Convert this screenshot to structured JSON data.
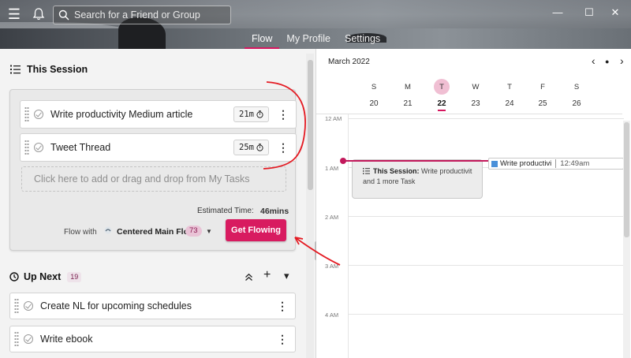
{
  "header": {
    "search_placeholder": "Search for a Friend or Group",
    "tabs": [
      {
        "label": "Flow",
        "active": true
      },
      {
        "label": "My Profile",
        "active": false
      },
      {
        "label": "Settings",
        "active": false
      }
    ],
    "window_controls": {
      "minimize": "—",
      "maximize": "☐",
      "close": "✕"
    },
    "menu_glyph": "☰"
  },
  "session": {
    "title": "This Session",
    "tasks": [
      {
        "title": "Write productivity Medium article",
        "time": "21m"
      },
      {
        "title": "Tweet Thread",
        "time": "25m"
      }
    ],
    "drop_zone_text": "Click here to add or drag and drop from My Tasks",
    "estimated_label": "Estimated Time:",
    "estimated_value": "46mins",
    "flow_with_label": "Flow with",
    "flow_name": "Centered Main Flow",
    "flow_count": "73",
    "flow_caret": "▼",
    "get_flowing_label": "Get Flowing"
  },
  "up_next": {
    "title": "Up Next",
    "count": "19",
    "collapse_glyph": "⌃",
    "add_glyph": "+",
    "dropdown_glyph": "▾",
    "tasks": [
      {
        "title": "Create NL for upcoming schedules"
      },
      {
        "title": "Write ebook"
      }
    ]
  },
  "calendar": {
    "month": "March 2022",
    "nav": {
      "prev": "‹",
      "today": "●",
      "next": "›"
    },
    "days": [
      {
        "name": "S",
        "num": "20"
      },
      {
        "name": "M",
        "num": "21"
      },
      {
        "name": "T",
        "num": "22",
        "today": true
      },
      {
        "name": "W",
        "num": "23"
      },
      {
        "name": "T",
        "num": "24"
      },
      {
        "name": "F",
        "num": "25"
      },
      {
        "name": "S",
        "num": "26"
      }
    ],
    "hours": [
      "12 AM",
      "1 AM",
      "2 AM",
      "3 AM",
      "4 AM"
    ],
    "session_event": {
      "title": "This Session:",
      "line1": "Write productivit",
      "line2": "and 1 more Task"
    },
    "mini_event": {
      "title": "Write productivi",
      "time": "12:49am"
    }
  },
  "colors": {
    "accent": "#d81b60",
    "now_line": "#c2185b",
    "annotation": "#e41b23"
  },
  "kebab_glyph": "⋮"
}
